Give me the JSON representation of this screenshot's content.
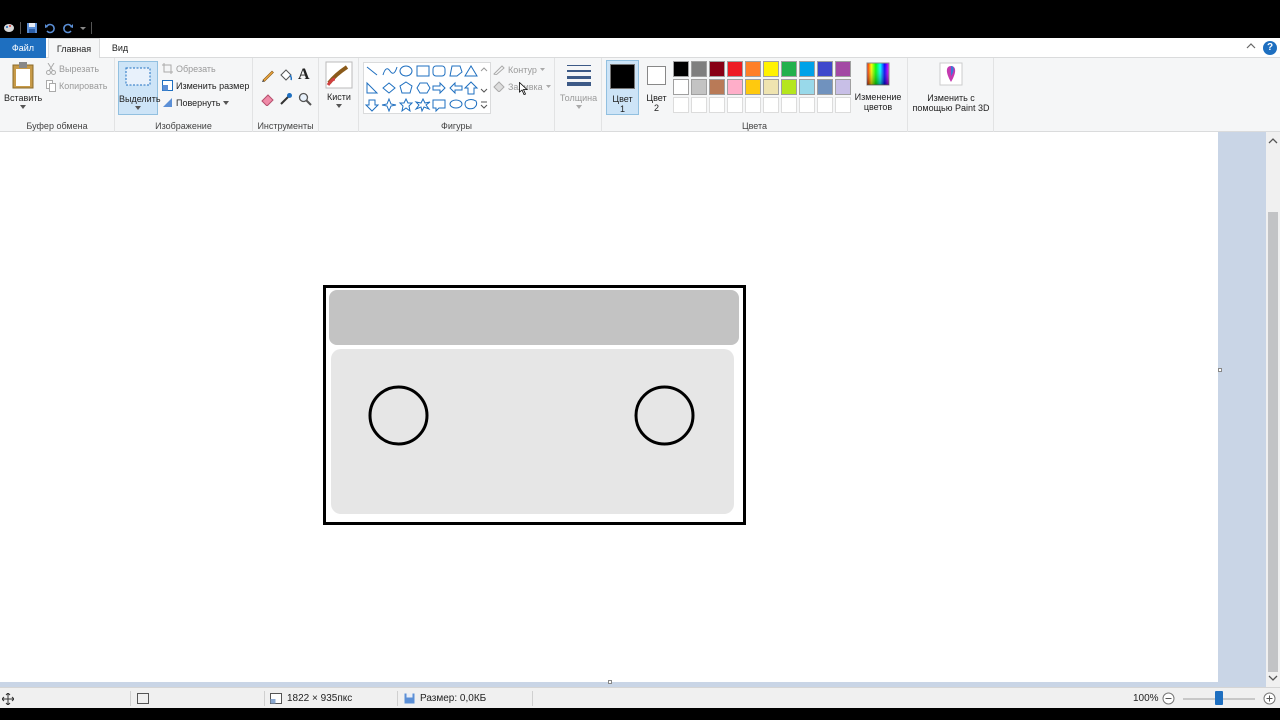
{
  "menu": {
    "file": "Файл",
    "home": "Главная",
    "view": "Вид",
    "help_glyph": "?"
  },
  "ribbon": {
    "clipboard": {
      "label": "Буфер обмена",
      "paste": "Вставить",
      "cut": "Вырезать",
      "copy": "Копировать"
    },
    "image": {
      "label": "Изображение",
      "select": "Выделить",
      "crop": "Обрезать",
      "resize": "Изменить размер",
      "rotate": "Повернуть"
    },
    "tools": {
      "label": "Инструменты",
      "text_glyph": "A"
    },
    "brushes": {
      "label": "Кисти"
    },
    "shapes": {
      "label": "Фигуры",
      "outline": "Контур",
      "fill": "Заливка"
    },
    "size": {
      "label": "Толщина"
    },
    "colors": {
      "label": "Цвета",
      "color1_line1": "Цвет",
      "color1_line2": "1",
      "color2_line1": "Цвет",
      "color2_line2": "2",
      "edit_line1": "Изменение",
      "edit_line2": "цветов",
      "color1_value": "#000000",
      "color2_value": "#ffffff",
      "palette_row1": [
        "#000000",
        "#7f7f7f",
        "#880015",
        "#ed1c24",
        "#ff7f27",
        "#fff200",
        "#22b14c",
        "#00a2e8",
        "#3f48cc",
        "#a349a4"
      ],
      "palette_row2": [
        "#ffffff",
        "#c3c3c3",
        "#b97a57",
        "#ffaec9",
        "#ffc90e",
        "#efe4b0",
        "#b5e61d",
        "#99d9ea",
        "#7092be",
        "#c8bfe7"
      ]
    },
    "paint3d": {
      "line1": "Изменить с",
      "line2": "помощью Paint 3D"
    }
  },
  "status": {
    "dimensions": "1822 × 935пкс",
    "size": "Размер: 0,0КБ",
    "zoom": "100%"
  }
}
